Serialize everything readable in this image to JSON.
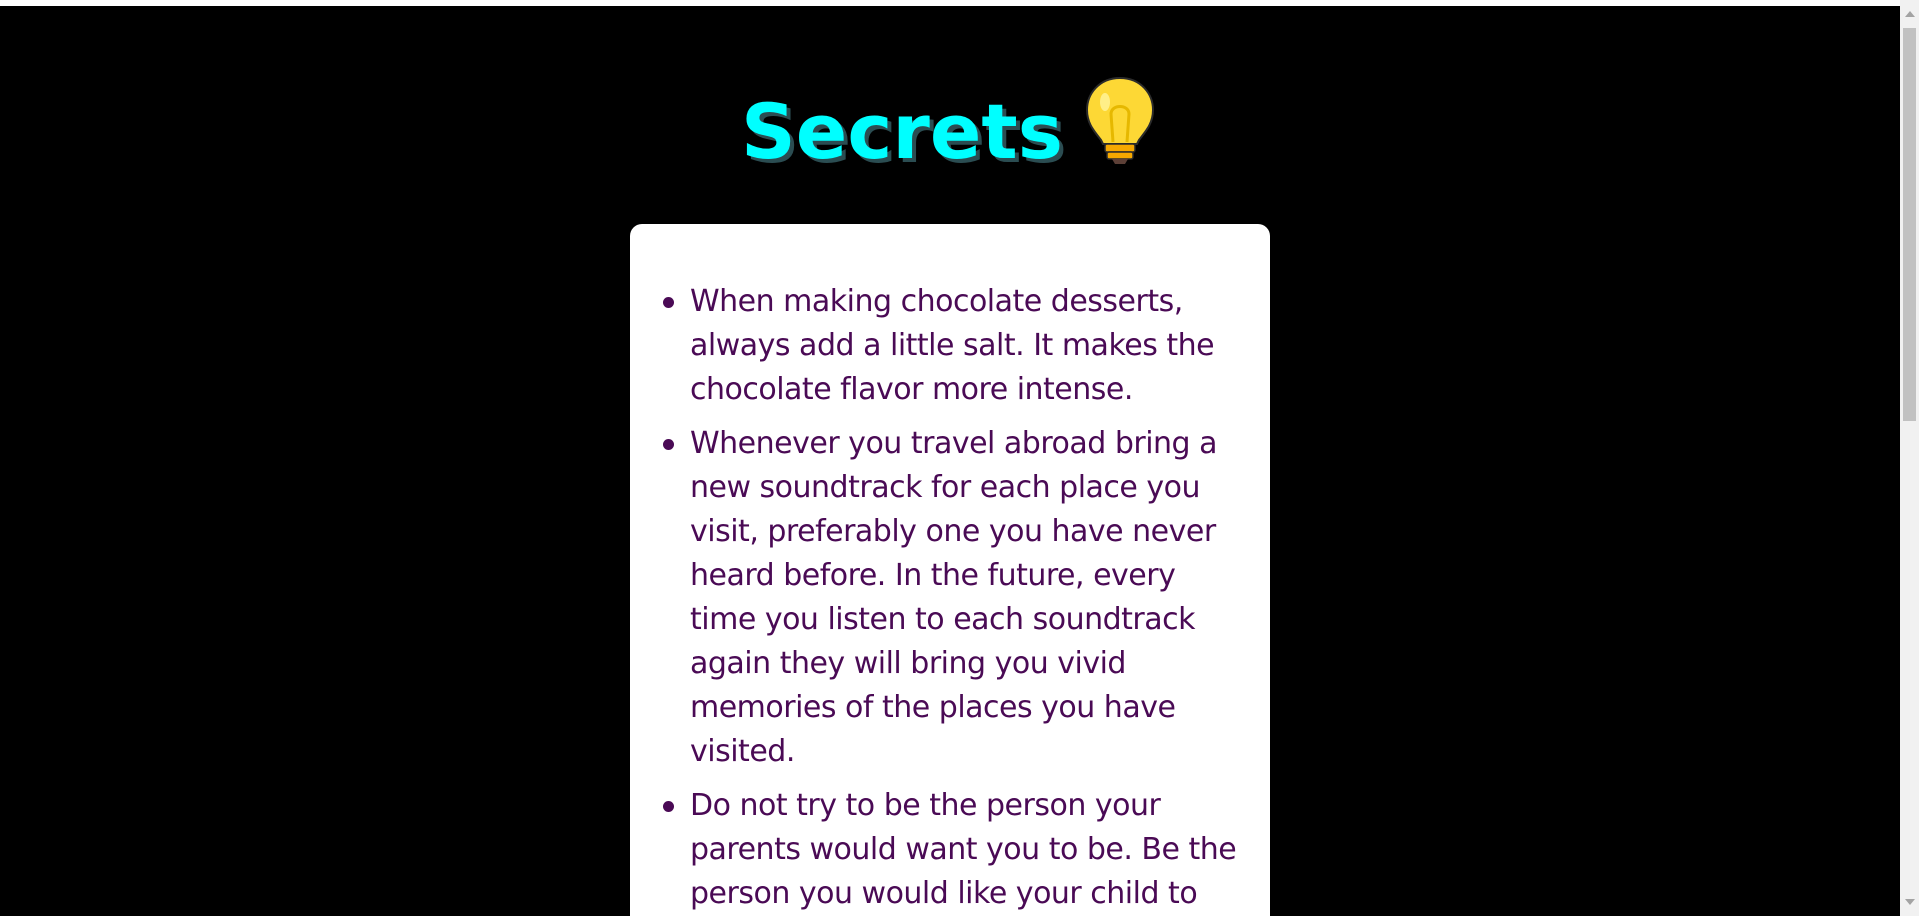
{
  "page": {
    "title": "Secrets",
    "title_icon": "lightbulb-icon"
  },
  "colors": {
    "background": "#000000",
    "title": "#00ffff",
    "card": "#ffffff",
    "text": "#4a0a55"
  },
  "secrets": [
    "When making chocolate desserts, always add a little salt. It makes the chocolate flavor more intense.",
    "Whenever you travel abroad bring a new soundtrack for each place you visit, preferably one you have never heard before. In the future, every time you listen to each soundtrack again they will bring you vivid memories of the places you have visited.",
    "Do not try to be the person your parents would want you to be. Be the person you would like your child to"
  ],
  "scrollbar": {
    "scroll_fraction": 0.0
  }
}
